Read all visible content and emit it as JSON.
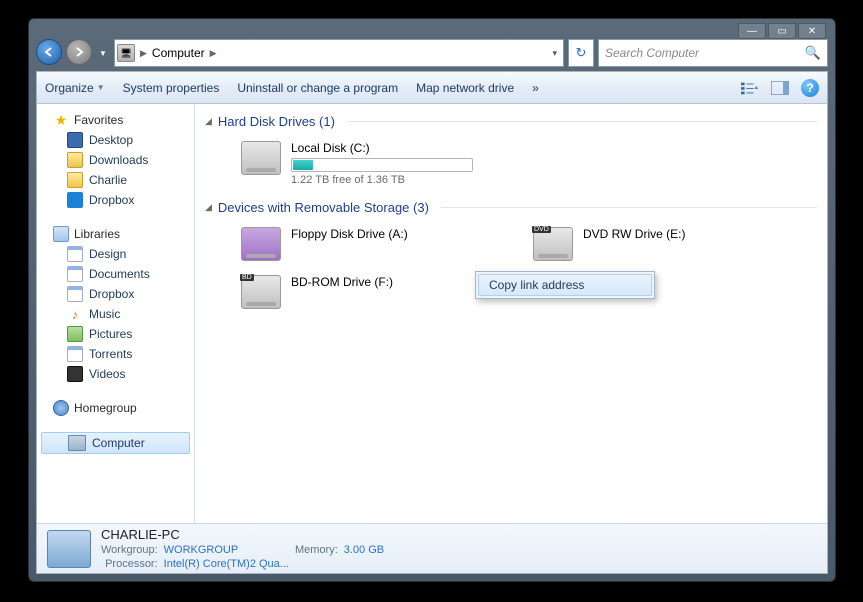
{
  "titlebar": {
    "min": "—",
    "max": "▭",
    "close": "✕"
  },
  "address": {
    "location": "Computer",
    "search_placeholder": "Search Computer"
  },
  "toolbar": {
    "organize": "Organize",
    "sysprops": "System properties",
    "uninstall": "Uninstall or change a program",
    "mapdrive": "Map network drive",
    "chevrons": "»"
  },
  "sidebar": {
    "favorites": {
      "label": "Favorites",
      "items": [
        "Desktop",
        "Downloads",
        "Charlie",
        "Dropbox"
      ]
    },
    "libraries": {
      "label": "Libraries",
      "items": [
        "Design",
        "Documents",
        "Dropbox",
        "Music",
        "Pictures",
        "Torrents",
        "Videos"
      ]
    },
    "homegroup": {
      "label": "Homegroup"
    },
    "computer": {
      "label": "Computer"
    }
  },
  "sections": {
    "hdd": "Hard Disk Drives (1)",
    "removable": "Devices with Removable Storage (3)"
  },
  "drives": {
    "local": {
      "name": "Local Disk (C:)",
      "free": "1.22 TB free of 1.36 TB"
    },
    "floppy": {
      "name": "Floppy Disk Drive (A:)"
    },
    "dvd": {
      "name": "DVD RW Drive (E:)",
      "tag": "DVD"
    },
    "bd": {
      "name": "BD-ROM Drive (F:)",
      "tag": "BD"
    }
  },
  "context_menu": {
    "item": "Copy link address"
  },
  "details": {
    "name": "CHARLIE-PC",
    "workgroup_lbl": "Workgroup:",
    "workgroup": "WORKGROUP",
    "memory_lbl": "Memory:",
    "memory": "3.00 GB",
    "processor_lbl": "Processor:",
    "processor": "Intel(R) Core(TM)2 Qua..."
  }
}
